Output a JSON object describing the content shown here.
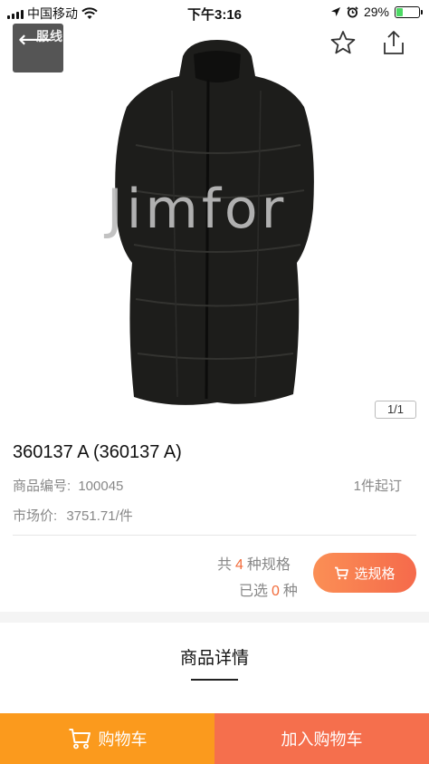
{
  "status_bar": {
    "carrier": "中国移动",
    "time": "下午3:16",
    "battery_percent": "29%",
    "battery_level": 0.29
  },
  "gallery": {
    "logo_text": "服线",
    "watermark": "Jimfor",
    "page_indicator": "1/1"
  },
  "product": {
    "title": "360137 A (360137 A)",
    "code_label": "商品编号:",
    "code_value": "100045",
    "min_order": "1件起订",
    "market_price_label": "市场价:",
    "market_price_value": "3751.71/件"
  },
  "spec": {
    "total_prefix": "共",
    "total_count": "4",
    "total_suffix": "种规格",
    "selected_prefix": "已选",
    "selected_count": "0",
    "selected_suffix": "种",
    "choose_button": "选规格"
  },
  "details": {
    "title": "商品详情"
  },
  "bottom_bar": {
    "cart_label": "购物车",
    "add_to_cart_label": "加入购物车"
  },
  "colors": {
    "accent_orange": "#fb9a1d",
    "accent_red": "#f56f4d",
    "highlight_number": "#f26b3a"
  },
  "icons": {
    "back": "back-arrow-icon",
    "favorite": "star-icon",
    "share": "share-icon",
    "cart": "cart-icon"
  }
}
